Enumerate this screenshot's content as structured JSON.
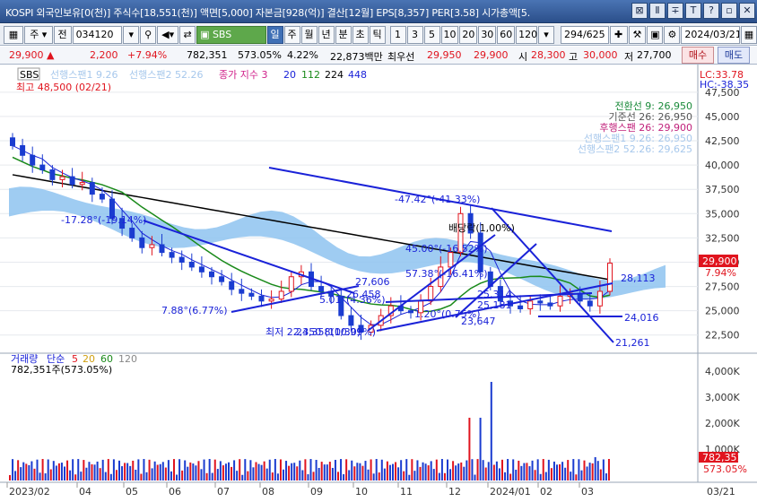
{
  "titlebar": {
    "text": "KOSPI 외국인보유[0(천)] 주식수[18,551(천)] 액면[5,000] 자본금[928(억)] 결산[12월] EPS[8,357] PER[3.58] 시가총액[5.",
    "buttons": [
      "⊠",
      "Ⅱ",
      "∓",
      "T",
      "?",
      "▫",
      "✕"
    ]
  },
  "toolbar": {
    "grid_icon": "grid-icon",
    "type_label": "주",
    "prev_label": "전",
    "code": "034120",
    "search_icon": "magnifier",
    "name": "SBS",
    "periods": [
      "일",
      "주",
      "월",
      "년",
      "분",
      "초",
      "틱"
    ],
    "active_period": "일",
    "intervals": [
      "1",
      "3",
      "5",
      "10",
      "20",
      "30",
      "60",
      "120"
    ],
    "count": "294",
    "total": "/625",
    "date": "2024/03/21"
  },
  "pricebar": {
    "price": "29,900 ▲",
    "change": "2,200",
    "rate": "+7.94%",
    "volume": "782,351",
    "vol_rate": "573.05%",
    "turnover": "4.22%",
    "amount": "22,873백만",
    "pref_label": "최우선",
    "ask": "29,950",
    "bid": "29,900",
    "open_label": "시",
    "open": "28,300",
    "high_label": "고",
    "high": "30,000",
    "low_label": "저",
    "low": "27,700",
    "buy": "매수",
    "sell": "매도"
  },
  "legend": {
    "code": "SBS",
    "span1": "선행스팬1 9.26",
    "span2": "선행스팬2 52.26",
    "close_idx": "종가 지수 3",
    "ma": [
      "20",
      "112",
      "224",
      "448"
    ]
  },
  "annotations": {
    "high_marker": "최고 48,500 (02/21)",
    "low_marker": "최저 22,350 (10/30)",
    "lc": "LC:33.78",
    "hc": "HC:-38.35",
    "ichimoku_labels": [
      "전환선 9: 26,950",
      "기준선 26: 26,950",
      "후행스팬 26: 29,900",
      "선행스팬1 9.26: 26,950",
      "선행스팬2 52.26: 29,625"
    ],
    "dividend": "배당락(1,00%)",
    "trend_labels": [
      "-17.28°(-19.14%)",
      "7.88°(6.77%)",
      "5.01°(4.36%)",
      "27,606",
      "-47.42°(-41.33%)",
      "45.00°(-16.52%)",
      "57.38°(-16.41%)",
      "1.20°(0.75%)",
      "25,314",
      "25,181",
      "23,647",
      "28,113",
      "24,016",
      "21,261",
      "26,458",
      "24,358(10.99%)"
    ]
  },
  "price_axis": [
    "47,500",
    "45,000",
    "42,500",
    "40,000",
    "37,500",
    "35,000",
    "32,500",
    "30,000",
    "27,500",
    "25,000",
    "22,500"
  ],
  "current_price_tag": "29,900",
  "current_rate_tag": "7.94%",
  "volume_panel": {
    "legend_title": "거래량",
    "legend_ma_label": "단순",
    "legend_ma": [
      "5",
      "20",
      "60",
      "120"
    ],
    "current": "782,351주(573.05%)",
    "axis": [
      "4,000K",
      "3,000K",
      "2,000K",
      "1,000K"
    ],
    "tag_value": "782,351",
    "tag_rate": "573.05%"
  },
  "date_axis": [
    "2023/02",
    "04",
    "05",
    "06",
    "07",
    "08",
    "09",
    "10",
    "11",
    "12",
    "2024/01",
    "02",
    "03",
    "03/21"
  ],
  "colors": {
    "up": "#e0141e",
    "down": "#1a3cd0",
    "cloud": "#8ec3f0",
    "ma224": "#000000",
    "ma112": "#1a8a1a",
    "trend": "#1a22d8"
  },
  "chart_data": {
    "type": "candlestick",
    "title": "SBS",
    "y_range": [
      21000,
      48500
    ],
    "close_series_approx": [
      42000,
      41000,
      40000,
      39500,
      38500,
      38800,
      38000,
      38200,
      37000,
      36500,
      34500,
      33500,
      32500,
      31500,
      31800,
      31000,
      30500,
      30000,
      29500,
      29000,
      28500,
      28000,
      27200,
      26800,
      26500,
      26000,
      26200,
      27000,
      28500,
      29000,
      27500,
      27000,
      26500,
      24500,
      23500,
      22800,
      23500,
      24500,
      25500,
      25000,
      24800,
      26000,
      27500,
      29500,
      31000,
      35000,
      33000,
      29000,
      27500,
      26000,
      25500,
      25200,
      26000,
      25800,
      25500,
      26500,
      26800,
      26000,
      25500,
      27000,
      29900
    ]
  }
}
